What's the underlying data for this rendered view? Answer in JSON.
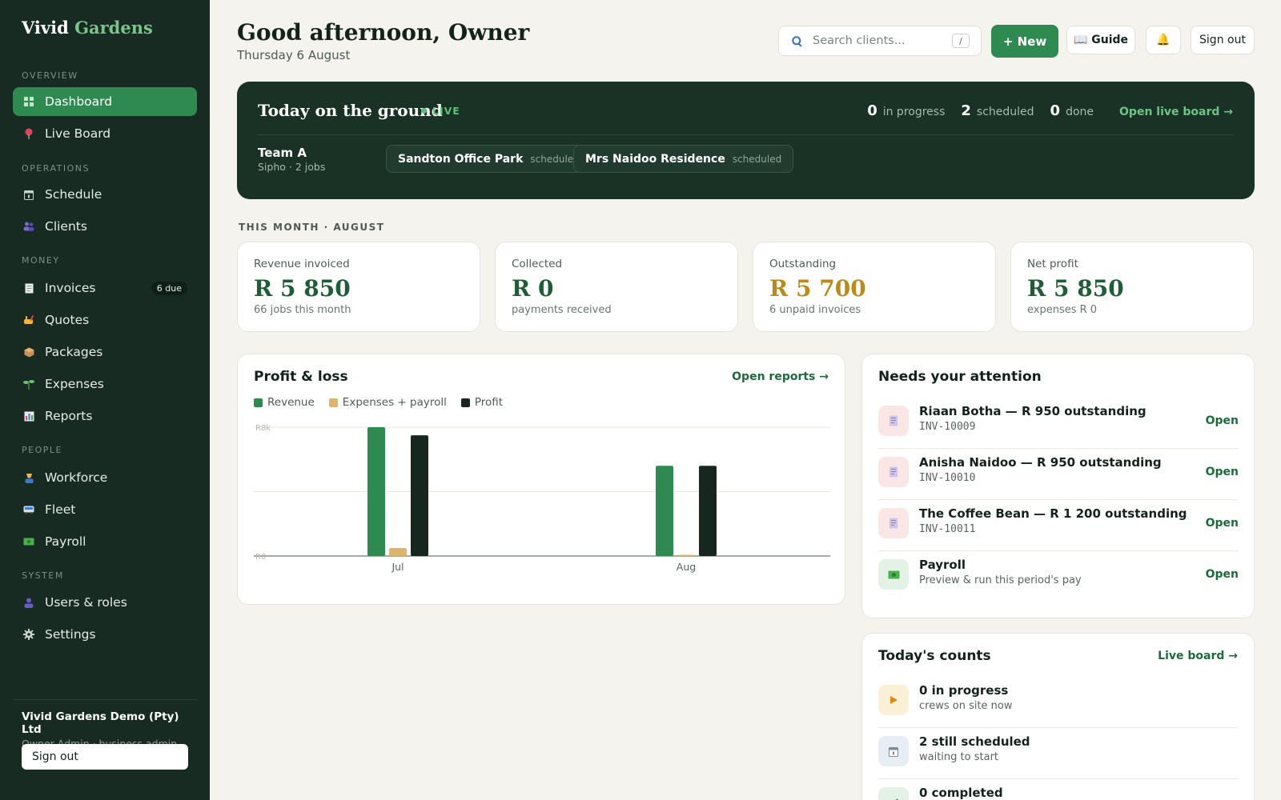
{
  "brand": {
    "name": "Vivid",
    "accent": "Gardens"
  },
  "sidebar": {
    "sections": [
      "OVERVIEW",
      "OPERATIONS",
      "MONEY",
      "PEOPLE",
      "SYSTEM"
    ],
    "items": [
      {
        "label": "Dashboard",
        "icon": "grid-icon"
      },
      {
        "label": "Live Board",
        "icon": "pin-icon"
      },
      {
        "label": "Schedule",
        "icon": "calendar-icon"
      },
      {
        "label": "Clients",
        "icon": "people-icon"
      },
      {
        "label": "Invoices",
        "icon": "invoice-icon",
        "badge": "6 due"
      },
      {
        "label": "Quotes",
        "icon": "quote-hand-icon"
      },
      {
        "label": "Packages",
        "icon": "package-icon"
      },
      {
        "label": "Expenses",
        "icon": "sprout-icon"
      },
      {
        "label": "Reports",
        "icon": "bar-chart-icon"
      },
      {
        "label": "Workforce",
        "icon": "worker-icon"
      },
      {
        "label": "Fleet",
        "icon": "bus-icon"
      },
      {
        "label": "Payroll",
        "icon": "cash-icon"
      },
      {
        "label": "Users & roles",
        "icon": "user-icon"
      },
      {
        "label": "Settings",
        "icon": "gear-icon"
      }
    ],
    "org": {
      "name": "Vivid Gardens Demo (Pty) Ltd",
      "role": "Owner Admin · business admin"
    },
    "signout": "Sign out"
  },
  "header": {
    "greeting": "Good afternoon, Owner",
    "date": "Thursday 6 August",
    "search_placeholder": "Search clients...",
    "search_shortcut": "/",
    "new_label": "+ New",
    "guide_label": "📖 Guide",
    "bell": "🔔",
    "signout": "Sign out"
  },
  "ground": {
    "title": "Today on the ground",
    "live": "LIVE",
    "stats": [
      {
        "num": "0",
        "label": "in progress"
      },
      {
        "num": "2",
        "label": "scheduled"
      },
      {
        "num": "0",
        "label": "done"
      }
    ],
    "open_link": "Open live board →",
    "team": {
      "name": "Team A",
      "sub": "Sipho · 2 jobs"
    },
    "jobs": [
      {
        "name": "Sandton Office Park",
        "status": "scheduled"
      },
      {
        "name": "Mrs Naidoo Residence",
        "status": "scheduled"
      }
    ]
  },
  "month_label": "THIS MONTH · AUGUST",
  "kpis": [
    {
      "label": "Revenue invoiced",
      "value": "R 5 850",
      "sub": "66 jobs this month"
    },
    {
      "label": "Collected",
      "value": "R 0",
      "sub": "payments received"
    },
    {
      "label": "Outstanding",
      "value": "R 5 700",
      "sub": "6 unpaid invoices"
    },
    {
      "label": "Net profit",
      "value": "R 5 850",
      "sub": "expenses R 0"
    }
  ],
  "pl": {
    "title": "Profit & loss",
    "link": "Open reports →"
  },
  "chart_data": {
    "type": "bar",
    "categories": [
      "Jul",
      "Aug"
    ],
    "series": [
      {
        "name": "Revenue",
        "values": [
          8000,
          5600
        ],
        "color": "#2f8a51"
      },
      {
        "name": "Expenses + payroll",
        "values": [
          500,
          0
        ],
        "color": "#dcb56c"
      },
      {
        "name": "Profit",
        "values": [
          7500,
          5600
        ],
        "color": "#17261f"
      }
    ],
    "ylim": [
      0,
      8000
    ],
    "yticks": [
      "R0",
      "R8k"
    ],
    "grid": true,
    "legend": "top-left"
  },
  "attention": {
    "title": "Needs your attention",
    "items": [
      {
        "title": "Riaan Botha — R 950 outstanding",
        "sub": "INV-10009",
        "open": "Open",
        "icon": "receipt-icon"
      },
      {
        "title": "Anisha Naidoo — R 950 outstanding",
        "sub": "INV-10010",
        "open": "Open",
        "icon": "receipt-icon"
      },
      {
        "title": "The Coffee Bean — R 1 200 outstanding",
        "sub": "INV-10011",
        "open": "Open",
        "icon": "receipt-icon"
      },
      {
        "title": "Payroll",
        "sub": "Preview & run this period's pay",
        "open": "Open",
        "icon": "cash-icon"
      }
    ]
  },
  "counts": {
    "title": "Today's counts",
    "link": "Live board →",
    "items": [
      {
        "title": "0 in progress",
        "sub": "crews on site now",
        "icon": "play-icon"
      },
      {
        "title": "2 still scheduled",
        "sub": "waiting to start",
        "icon": "calendar-icon"
      },
      {
        "title": "0 completed",
        "sub": "",
        "icon": "check-icon"
      }
    ]
  }
}
